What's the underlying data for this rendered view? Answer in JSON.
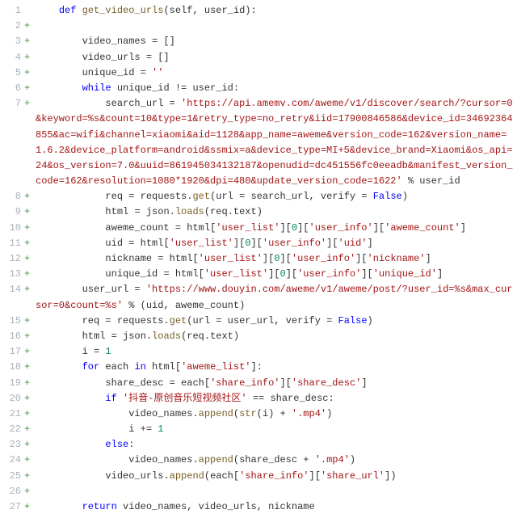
{
  "lines": [
    {
      "n": 1,
      "mark": "",
      "indent": 1,
      "tokens": [
        [
          "kw",
          "def "
        ],
        [
          "fn",
          "get_video_urls"
        ],
        [
          "op",
          "("
        ],
        [
          "id",
          "self"
        ],
        [
          "op",
          ", "
        ],
        [
          "id",
          "user_id"
        ],
        [
          "op",
          "):"
        ]
      ]
    },
    {
      "n": 2,
      "mark": "+",
      "indent": 0,
      "tokens": []
    },
    {
      "n": 3,
      "mark": "+",
      "indent": 2,
      "tokens": [
        [
          "id",
          "video_names "
        ],
        [
          "op",
          "= []"
        ]
      ]
    },
    {
      "n": 4,
      "mark": "+",
      "indent": 2,
      "tokens": [
        [
          "id",
          "video_urls "
        ],
        [
          "op",
          "= []"
        ]
      ]
    },
    {
      "n": 5,
      "mark": "+",
      "indent": 2,
      "tokens": [
        [
          "id",
          "unique_id "
        ],
        [
          "op",
          "= "
        ],
        [
          "str",
          "''"
        ]
      ]
    },
    {
      "n": 6,
      "mark": "+",
      "indent": 2,
      "tokens": [
        [
          "kw",
          "while "
        ],
        [
          "id",
          "unique_id "
        ],
        [
          "op",
          "!= "
        ],
        [
          "id",
          "user_id"
        ],
        [
          "op",
          ":"
        ]
      ]
    },
    {
      "n": 7,
      "mark": "+",
      "indent": 3,
      "tokens": [
        [
          "id",
          "search_url "
        ],
        [
          "op",
          "= "
        ],
        [
          "str",
          "'https://api.amemv.com/aweme/v1/discover/search/?cursor=0&keyword=%s&count=10&type=1&retry_type=no_retry&iid=17900846586&device_id=34692364855&ac=wifi&channel=xiaomi&aid=1128&app_name=aweme&version_code=162&version_name=1.6.2&device_platform=android&ssmix=a&device_type=MI+5&device_brand=Xiaomi&os_api=24&os_version=7.0&uuid=861945034132187&openudid=dc451556fc0eeadb&manifest_version_code=162&resolution=1080*1920&dpi=480&update_version_code=1622'"
        ],
        [
          "op",
          " % "
        ],
        [
          "id",
          "user_id"
        ]
      ]
    },
    {
      "n": 8,
      "mark": "+",
      "indent": 3,
      "tokens": [
        [
          "id",
          "req "
        ],
        [
          "op",
          "= "
        ],
        [
          "id",
          "requests"
        ],
        [
          "op",
          "."
        ],
        [
          "fn",
          "get"
        ],
        [
          "op",
          "("
        ],
        [
          "id",
          "url "
        ],
        [
          "op",
          "= "
        ],
        [
          "id",
          "search_url"
        ],
        [
          "op",
          ", "
        ],
        [
          "id",
          "verify "
        ],
        [
          "op",
          "= "
        ],
        [
          "kw",
          "False"
        ],
        [
          "op",
          ")"
        ]
      ]
    },
    {
      "n": 9,
      "mark": "+",
      "indent": 3,
      "tokens": [
        [
          "id",
          "html "
        ],
        [
          "op",
          "= "
        ],
        [
          "id",
          "json"
        ],
        [
          "op",
          "."
        ],
        [
          "fn",
          "loads"
        ],
        [
          "op",
          "("
        ],
        [
          "id",
          "req"
        ],
        [
          "op",
          "."
        ],
        [
          "id",
          "text"
        ],
        [
          "op",
          ")"
        ]
      ]
    },
    {
      "n": 10,
      "mark": "+",
      "indent": 3,
      "tokens": [
        [
          "id",
          "aweme_count "
        ],
        [
          "op",
          "= "
        ],
        [
          "id",
          "html"
        ],
        [
          "op",
          "["
        ],
        [
          "str",
          "'user_list'"
        ],
        [
          "op",
          "]["
        ],
        [
          "num",
          "0"
        ],
        [
          "op",
          "]["
        ],
        [
          "str",
          "'user_info'"
        ],
        [
          "op",
          "]["
        ],
        [
          "str",
          "'aweme_count'"
        ],
        [
          "op",
          "]"
        ]
      ]
    },
    {
      "n": 11,
      "mark": "+",
      "indent": 3,
      "tokens": [
        [
          "id",
          "uid "
        ],
        [
          "op",
          "= "
        ],
        [
          "id",
          "html"
        ],
        [
          "op",
          "["
        ],
        [
          "str",
          "'user_list'"
        ],
        [
          "op",
          "]["
        ],
        [
          "num",
          "0"
        ],
        [
          "op",
          "]["
        ],
        [
          "str",
          "'user_info'"
        ],
        [
          "op",
          "]["
        ],
        [
          "str",
          "'uid'"
        ],
        [
          "op",
          "]"
        ]
      ]
    },
    {
      "n": 12,
      "mark": "+",
      "indent": 3,
      "tokens": [
        [
          "id",
          "nickname "
        ],
        [
          "op",
          "= "
        ],
        [
          "id",
          "html"
        ],
        [
          "op",
          "["
        ],
        [
          "str",
          "'user_list'"
        ],
        [
          "op",
          "]["
        ],
        [
          "num",
          "0"
        ],
        [
          "op",
          "]["
        ],
        [
          "str",
          "'user_info'"
        ],
        [
          "op",
          "]["
        ],
        [
          "str",
          "'nickname'"
        ],
        [
          "op",
          "]"
        ]
      ]
    },
    {
      "n": 13,
      "mark": "+",
      "indent": 3,
      "tokens": [
        [
          "id",
          "unique_id "
        ],
        [
          "op",
          "= "
        ],
        [
          "id",
          "html"
        ],
        [
          "op",
          "["
        ],
        [
          "str",
          "'user_list'"
        ],
        [
          "op",
          "]["
        ],
        [
          "num",
          "0"
        ],
        [
          "op",
          "]["
        ],
        [
          "str",
          "'user_info'"
        ],
        [
          "op",
          "]["
        ],
        [
          "str",
          "'unique_id'"
        ],
        [
          "op",
          "]"
        ]
      ]
    },
    {
      "n": 14,
      "mark": "+",
      "indent": 2,
      "tokens": [
        [
          "id",
          "user_url "
        ],
        [
          "op",
          "= "
        ],
        [
          "str",
          "'https://www.douyin.com/aweme/v1/aweme/post/?user_id=%s&max_cursor=0&count=%s'"
        ],
        [
          "op",
          " % ("
        ],
        [
          "id",
          "uid"
        ],
        [
          "op",
          ", "
        ],
        [
          "id",
          "aweme_count"
        ],
        [
          "op",
          ")"
        ]
      ]
    },
    {
      "n": 15,
      "mark": "+",
      "indent": 2,
      "tokens": [
        [
          "id",
          "req "
        ],
        [
          "op",
          "= "
        ],
        [
          "id",
          "requests"
        ],
        [
          "op",
          "."
        ],
        [
          "fn",
          "get"
        ],
        [
          "op",
          "("
        ],
        [
          "id",
          "url "
        ],
        [
          "op",
          "= "
        ],
        [
          "id",
          "user_url"
        ],
        [
          "op",
          ", "
        ],
        [
          "id",
          "verify "
        ],
        [
          "op",
          "= "
        ],
        [
          "kw",
          "False"
        ],
        [
          "op",
          ")"
        ]
      ]
    },
    {
      "n": 16,
      "mark": "+",
      "indent": 2,
      "tokens": [
        [
          "id",
          "html "
        ],
        [
          "op",
          "= "
        ],
        [
          "id",
          "json"
        ],
        [
          "op",
          "."
        ],
        [
          "fn",
          "loads"
        ],
        [
          "op",
          "("
        ],
        [
          "id",
          "req"
        ],
        [
          "op",
          "."
        ],
        [
          "id",
          "text"
        ],
        [
          "op",
          ")"
        ]
      ]
    },
    {
      "n": 17,
      "mark": "+",
      "indent": 2,
      "tokens": [
        [
          "id",
          "i "
        ],
        [
          "op",
          "= "
        ],
        [
          "num",
          "1"
        ]
      ]
    },
    {
      "n": 18,
      "mark": "+",
      "indent": 2,
      "tokens": [
        [
          "kw",
          "for "
        ],
        [
          "id",
          "each "
        ],
        [
          "kw",
          "in "
        ],
        [
          "id",
          "html"
        ],
        [
          "op",
          "["
        ],
        [
          "str",
          "'aweme_list'"
        ],
        [
          "op",
          "]:"
        ]
      ]
    },
    {
      "n": 19,
      "mark": "+",
      "indent": 3,
      "tokens": [
        [
          "id",
          "share_desc "
        ],
        [
          "op",
          "= "
        ],
        [
          "id",
          "each"
        ],
        [
          "op",
          "["
        ],
        [
          "str",
          "'share_info'"
        ],
        [
          "op",
          "]["
        ],
        [
          "str",
          "'share_desc'"
        ],
        [
          "op",
          "]"
        ]
      ]
    },
    {
      "n": 20,
      "mark": "+",
      "indent": 3,
      "tokens": [
        [
          "kw",
          "if "
        ],
        [
          "str",
          "'抖音-原创音乐短视频社区'"
        ],
        [
          "op",
          " == "
        ],
        [
          "id",
          "share_desc"
        ],
        [
          "op",
          ":"
        ]
      ]
    },
    {
      "n": 21,
      "mark": "+",
      "indent": 4,
      "tokens": [
        [
          "id",
          "video_names"
        ],
        [
          "op",
          "."
        ],
        [
          "fn",
          "append"
        ],
        [
          "op",
          "("
        ],
        [
          "fn",
          "str"
        ],
        [
          "op",
          "("
        ],
        [
          "id",
          "i"
        ],
        [
          "op",
          ") + "
        ],
        [
          "str",
          "'.mp4'"
        ],
        [
          "op",
          ")"
        ]
      ]
    },
    {
      "n": 22,
      "mark": "+",
      "indent": 4,
      "tokens": [
        [
          "id",
          "i "
        ],
        [
          "op",
          "+= "
        ],
        [
          "num",
          "1"
        ]
      ]
    },
    {
      "n": 23,
      "mark": "+",
      "indent": 3,
      "tokens": [
        [
          "kw",
          "else"
        ],
        [
          "op",
          ":"
        ]
      ]
    },
    {
      "n": 24,
      "mark": "+",
      "indent": 4,
      "tokens": [
        [
          "id",
          "video_names"
        ],
        [
          "op",
          "."
        ],
        [
          "fn",
          "append"
        ],
        [
          "op",
          "("
        ],
        [
          "id",
          "share_desc "
        ],
        [
          "op",
          "+ "
        ],
        [
          "str",
          "'.mp4'"
        ],
        [
          "op",
          ")"
        ]
      ]
    },
    {
      "n": 25,
      "mark": "+",
      "indent": 3,
      "tokens": [
        [
          "id",
          "video_urls"
        ],
        [
          "op",
          "."
        ],
        [
          "fn",
          "append"
        ],
        [
          "op",
          "("
        ],
        [
          "id",
          "each"
        ],
        [
          "op",
          "["
        ],
        [
          "str",
          "'share_info'"
        ],
        [
          "op",
          "]["
        ],
        [
          "str",
          "'share_url'"
        ],
        [
          "op",
          "])"
        ]
      ]
    },
    {
      "n": 26,
      "mark": "+",
      "indent": 0,
      "tokens": []
    },
    {
      "n": 27,
      "mark": "+",
      "indent": 2,
      "tokens": [
        [
          "kw",
          "return "
        ],
        [
          "id",
          "video_names"
        ],
        [
          "op",
          ", "
        ],
        [
          "id",
          "video_urls"
        ],
        [
          "op",
          ", "
        ],
        [
          "id",
          "nickname"
        ]
      ]
    }
  ]
}
